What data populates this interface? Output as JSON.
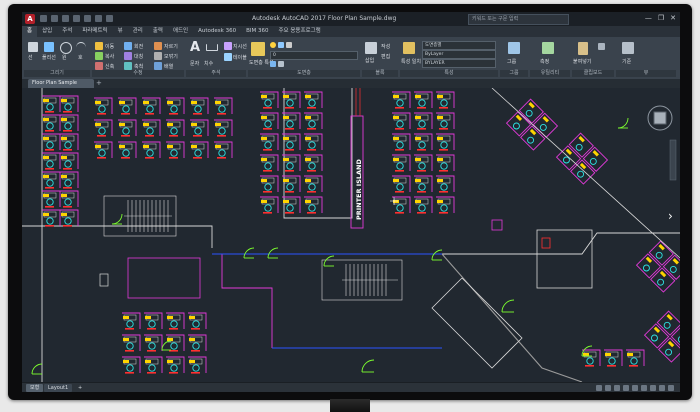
{
  "window": {
    "app_letter": "A",
    "title": "Autodesk AutoCAD 2017  Floor Plan Sample.dwg",
    "search_placeholder": "키워드 또는 구문 입력",
    "controls": [
      "—",
      "❐",
      "✕"
    ]
  },
  "menu_tabs": [
    {
      "label": "홈",
      "active": true
    },
    {
      "label": "삽입",
      "active": false
    },
    {
      "label": "주석",
      "active": false
    },
    {
      "label": "파라메트릭",
      "active": false
    },
    {
      "label": "뷰",
      "active": false
    },
    {
      "label": "관리",
      "active": false
    },
    {
      "label": "출력",
      "active": false
    },
    {
      "label": "애드인",
      "active": false
    },
    {
      "label": "Autodesk 360",
      "active": false
    },
    {
      "label": "BIM 360",
      "active": false
    },
    {
      "label": "주요 응용프로그램",
      "active": false
    }
  ],
  "ribbon": {
    "panels": [
      "그리기",
      "수정",
      "주석",
      "도면층",
      "블록",
      "특성",
      "그룹",
      "유틸리티",
      "클립보드",
      "뷰"
    ],
    "items": {
      "line": "선",
      "polyline": "폴리선",
      "circle": "원",
      "arc": "호",
      "move": "이동",
      "rotate": "회전",
      "trim": "자르기",
      "copy": "복사",
      "mirror": "대칭",
      "fillet": "모깎기",
      "stretch": "신축",
      "scale": "축척",
      "array": "배열",
      "text": "문자",
      "dimension": "치수",
      "leader": "지시선",
      "table": "테이블",
      "layer_properties": "도면층 특성",
      "insert": "삽입",
      "create": "작성",
      "edit": "편집",
      "match_properties": "특성 일치",
      "group": "그룹",
      "measure": "측정",
      "paste": "붙여넣기",
      "base": "기준"
    },
    "dropdowns": {
      "layer": "0",
      "color": "도면층별",
      "linetype": "ByLayer",
      "lineweight": "BYLAYER"
    }
  },
  "file_tab": {
    "name": "Floor Plan Sample",
    "add": "+"
  },
  "drawing": {
    "printer_label": "PRINTER ISLAND",
    "nav_arrow": "›",
    "colors": {
      "walls": "#e23ad9",
      "furniture": "#2ee6e6",
      "text": "#ff3030",
      "tags": "#ffd400",
      "doors": "#7dff2e",
      "outline": "#d8d8d8",
      "structure": "#9a9a9a",
      "blue": "#2b55ff"
    }
  },
  "status": {
    "tabs": [
      "모형",
      "Layout1",
      "+"
    ]
  }
}
